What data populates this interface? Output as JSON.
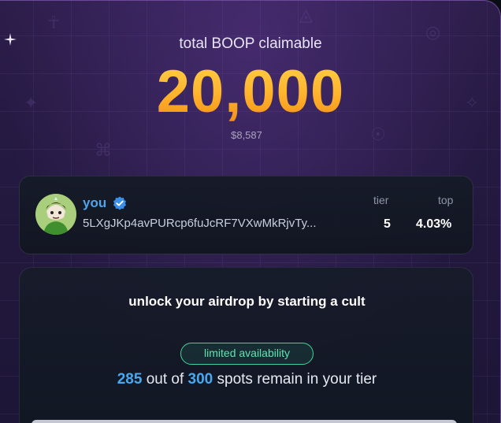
{
  "hero": {
    "label": "total BOOP claimable",
    "amount": "20,000",
    "usd": "$8,587"
  },
  "user": {
    "name": "you",
    "address": "5LXgJKp4avPURcp6fuJcRF7VXwMkRjvTy...",
    "tier_label": "tier",
    "tier_value": "5",
    "top_label": "top",
    "top_value": "4.03%"
  },
  "cult": {
    "title": "unlock your airdrop by starting a cult",
    "badge": "limited availability",
    "remaining": "285",
    "mid_text": "out of",
    "total": "300",
    "suffix": "spots remain in your tier"
  },
  "colors": {
    "accent_blue": "#47a9f0",
    "badge_green": "#3fd49a",
    "amount_orange": "#ffb22c"
  },
  "icons": [
    "verified-check-icon",
    "sparkle-icon",
    "avatar-image"
  ]
}
